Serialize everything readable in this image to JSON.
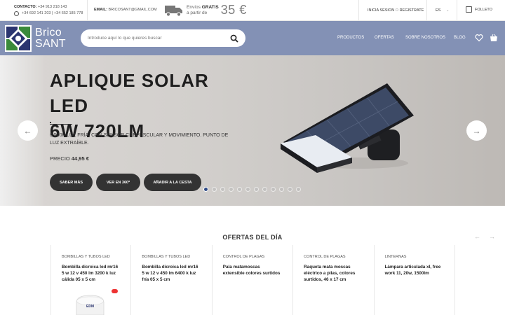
{
  "topbar": {
    "contact_label": "CONTACTO:",
    "contact_phone": "+34 913 218 143",
    "whatsapp_phones": "+34 692 141 203 | +34 652 185 778",
    "email_label": "EMAIL:",
    "email_value": "BRICOSANT@GMAIL.COM",
    "shipping_line1_prefix": "Envíos",
    "shipping_line1_bold": "GRATIS",
    "shipping_line2": "a partir de",
    "shipping_price": "35 €",
    "login": "INICIA SESION",
    "login_sep": "O",
    "register": "REGISTRATE",
    "language": "ES",
    "folleto": "FOLLETO"
  },
  "header": {
    "logo_line1": "Brico",
    "logo_line2": "SANT",
    "search_placeholder": "Introduce aquí lo que quieres buscar",
    "nav": [
      "PRODUCTOS",
      "OFERTAS",
      "SOBRE NOSOTROS",
      "BLOG"
    ]
  },
  "hero": {
    "title_line1": "APLIQUE SOLAR LED",
    "title_line2": "6W 720LM",
    "description": "6.500K LUZ FRÍA. CON SENSOR CREPUSCULAR Y MOVIMIENTO. PUNTO DE LUZ EXTRAÍBLE.",
    "price_label": "PRECIO",
    "price_value": "44,95 €",
    "buttons": [
      "SABER MÁS",
      "VER EN 360º",
      "AÑADIR A LA CESTA"
    ],
    "slide_count": 12,
    "active_slide": 1,
    "prev_arrow": "←",
    "next_arrow": "→"
  },
  "offers": {
    "title": "OFERTAS DEL DÍA",
    "prev_arrow": "←",
    "next_arrow": "→",
    "cards": [
      {
        "category": "BOMBILLAS Y TUBOS LED",
        "name": "Bombilla dicroica led mr16 5 w 12 v 450 lm 3200 k luz cálida 05 x 5 cm"
      },
      {
        "category": "BOMBILLAS Y TUBOS LED",
        "name": "Bombilla dicroica led mr16 5 w 12 v 450 lm 6400 k luz fría 05 x 5 cm"
      },
      {
        "category": "CONTROL DE PLAGAS",
        "name": "Pala matamoscas extensible colores surtidos"
      },
      {
        "category": "CONTROL DE PLAGAS",
        "name": "Raqueta mata moscas eléctrico a pilas, colores surtidos, 46 x 17 cm"
      },
      {
        "category": "LINTERNAS",
        "name": "Lámpara articulada xl, free work 11, 20w, 1500lm"
      }
    ],
    "bulb_brand": "EDM"
  },
  "colors": {
    "header_bg": "#8391b5",
    "dark_button": "#333333",
    "active_dot": "#2f4a86"
  }
}
